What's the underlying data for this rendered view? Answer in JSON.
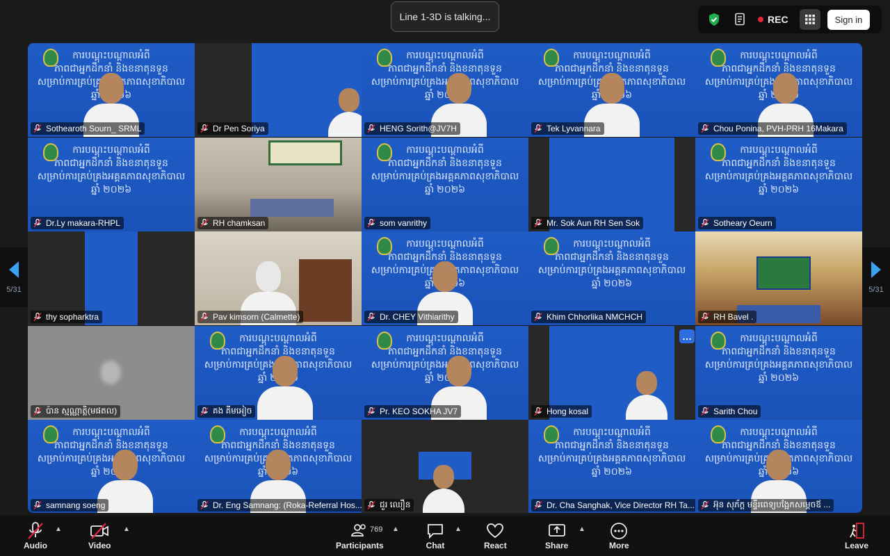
{
  "status": {
    "talking": "Line 1-3D is talking..."
  },
  "topbar": {
    "rec_label": "REC",
    "signin_label": "Sign in"
  },
  "colors": {
    "rec": "#e5283b",
    "security": "#1fae4b",
    "accent": "#2d6ee0",
    "slide_bg": "#1f5cc6"
  },
  "slide_lines": [
    "ការបណ្តុះបណ្តាលអំពី",
    "ភាពជាអ្នកដឹកនាំ និងខនាតុនទួន",
    "សម្រាប់ការគ្រប់គ្រងអគ្គគភាពសុខាភិបាល",
    "ឆ្នាំ ២០២៦"
  ],
  "pagination": {
    "left": "5/31",
    "right": "5/31"
  },
  "participants": [
    "Sothearoth Sourn_ SRML",
    "Dr Pen Soriya",
    "HENG Sorith@JV7H",
    "Tek Lyvannara",
    "Chou Ponina, PVH-PRH 16Makara",
    "Dr.Ly makara-RHPL",
    "RH chamksan",
    "som vanrithy",
    "Mr. Sok Aun RH Sen Sok",
    "Sotheary Oeurn",
    "thy sopharktra",
    "Pav kimsorn (Calmette)",
    "Dr. CHEY Vithiarithy",
    "Khim Chhorlika NMCHCH",
    "RH Bavel .",
    "ប៉ាន ស្មណ្ណាត្តិ(មផតល)",
    "គង គីមអៀច",
    "Pr. KEO SOKHA JV7",
    "Hong kosal",
    "Sarith Chou",
    "samnang soeng",
    "Dr. Eng Samnang: (Roka-Referral Hos...",
    "ជួរ ឈឿន",
    "Dr. Cha Sanghak, Vice Director RH Ta...",
    "អ៊ុន សុភ័ក្ត មន្ទីរពេទ្យបង្អែកសម្តេចឪ ..."
  ],
  "toolbar": {
    "audio": "Audio",
    "video": "Video",
    "participants": "Participants",
    "participants_count": "769",
    "chat": "Chat",
    "react": "React",
    "share": "Share",
    "more": "More",
    "leave": "Leave"
  }
}
